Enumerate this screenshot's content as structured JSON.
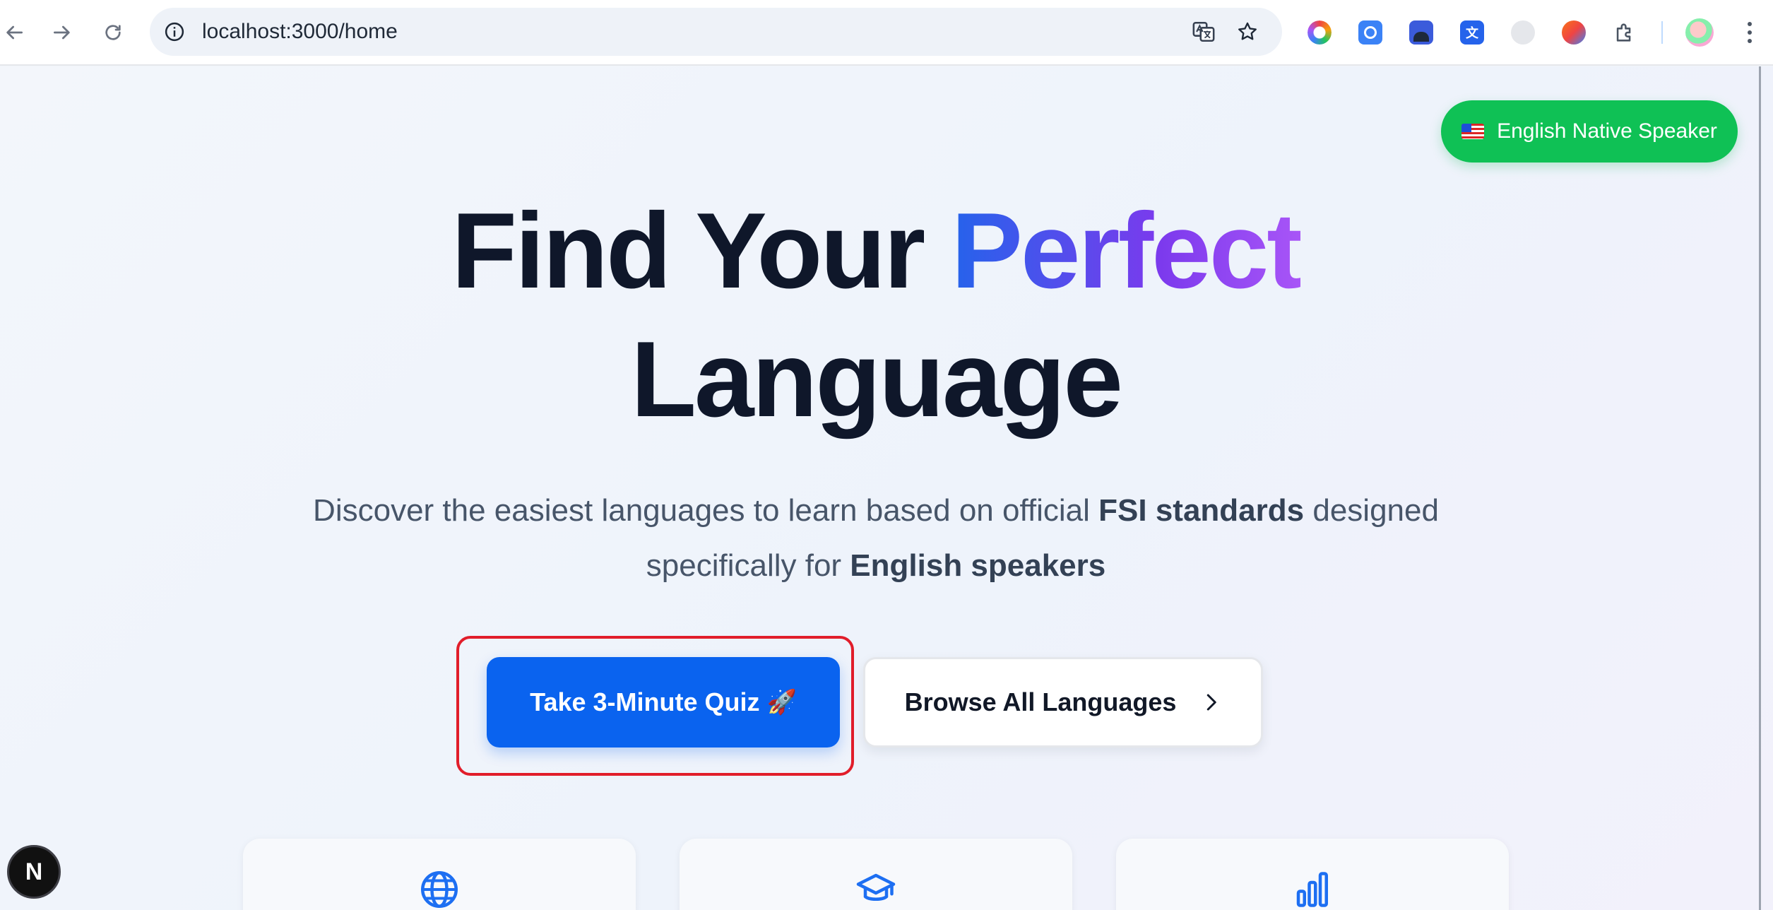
{
  "browser": {
    "url": "localhost:3000/home",
    "back_icon": "arrow-left-icon",
    "forward_icon": "arrow-right-icon",
    "reload_icon": "reload-icon",
    "extensions": [
      "color-wheel-extension-icon",
      "chat-extension-icon",
      "robot-extension-icon",
      "translate-extension-icon",
      "cloud-extension-icon",
      "fox-extension-icon",
      "puzzle-extensions-icon"
    ]
  },
  "page": {
    "native_pill_label": "English Native Speaker",
    "hero": {
      "title_part1": "Find Your ",
      "title_accent": "Perfect",
      "title_part2": "Language",
      "sub_part1": "Discover the easiest languages to learn based on official ",
      "sub_bold1": "FSI standards",
      "sub_part2": " designed specifically for ",
      "sub_bold2": "English speakers"
    },
    "cta": {
      "quiz_label": "Take 3-Minute Quiz",
      "quiz_emoji": "🚀",
      "browse_label": "Browse All Languages"
    },
    "features": [
      {
        "icon": "globe-icon"
      },
      {
        "icon": "graduation-cap-icon"
      },
      {
        "icon": "bar-chart-icon"
      }
    ],
    "next_badge": "N"
  },
  "colors": {
    "primary": "#0a63ef",
    "native_green": "#0fc155",
    "highlight_red": "#e11d2a",
    "accent_gradient_start": "#2563eb",
    "accent_gradient_end": "#a855f7"
  }
}
